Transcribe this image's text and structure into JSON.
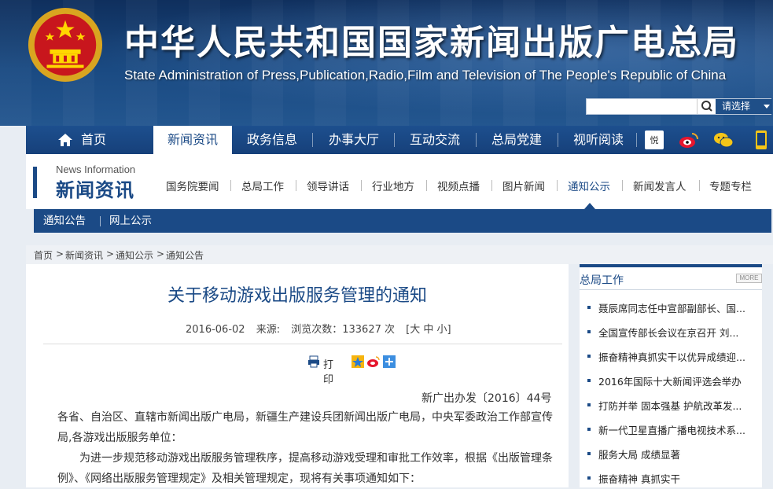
{
  "header": {
    "title_cn": "中华人民共和国国家新闻出版广电总局",
    "title_en": "State Administration of Press,Publication,Radio,Film and Television of The People's Republic of China",
    "search": {
      "value": "",
      "select_label": "请选择"
    }
  },
  "nav": {
    "items": [
      {
        "label": "首页"
      },
      {
        "label": "新闻资讯"
      },
      {
        "label": "政务信息"
      },
      {
        "label": "办事大厅"
      },
      {
        "label": "互动交流"
      },
      {
        "label": "总局党建"
      },
      {
        "label": "视听阅读"
      }
    ],
    "icons": [
      "yuedu-icon",
      "weibo-icon",
      "wechat-icon",
      "mobile-icon"
    ]
  },
  "section": {
    "en": "News Information",
    "cn": "新闻资讯",
    "subnav": [
      "国务院要闻",
      "总局工作",
      "领导讲话",
      "行业地方",
      "视频点播",
      "图片新闻",
      "通知公示",
      "新闻发言人",
      "专题专栏"
    ],
    "active_subnav": "通知公示",
    "subbar": [
      "通知公告",
      "网上公示"
    ]
  },
  "breadcrumb": [
    "首页",
    "新闻资讯",
    "通知公示",
    "通知公告"
  ],
  "article": {
    "title": "关于移动游戏出版服务管理的通知",
    "date": "2016-06-02",
    "source_label": "来源:",
    "views": "浏览次数：133627 次",
    "font_size": "[大 中 小]",
    "print_label": "打印",
    "doc_no": "新广出办发〔2016〕44号",
    "para1": "各省、自治区、直辖市新闻出版广电局，新疆生产建设兵团新闻出版广电局，中央军委政治工作部宣传局,各游戏出版服务单位：",
    "para2": "为进一步规范移动游戏出版服务管理秩序，提高移动游戏受理和审批工作效率，根据《出版管理条例》、《网络出版服务管理规定》及相关管理规定，现将有关事项通知如下："
  },
  "sidebar": {
    "title": "总局工作",
    "more": "MORE",
    "items": [
      "聂辰席同志任中宣部副部长、国...",
      "全国宣传部长会议在京召开 刘...",
      "振奋精神真抓实干以优异成绩迎...",
      "2016年国际十大新闻评选会举办",
      "打防并举 固本强基 护航改革发...",
      "新一代卫星直播广播电视技术系...",
      "服务大局 成绩显著",
      "振奋精神 真抓实干"
    ]
  },
  "colors": {
    "primary": "#1b4a86",
    "banner": "#1a4a82",
    "title_red_emblem": "#c8161d"
  }
}
